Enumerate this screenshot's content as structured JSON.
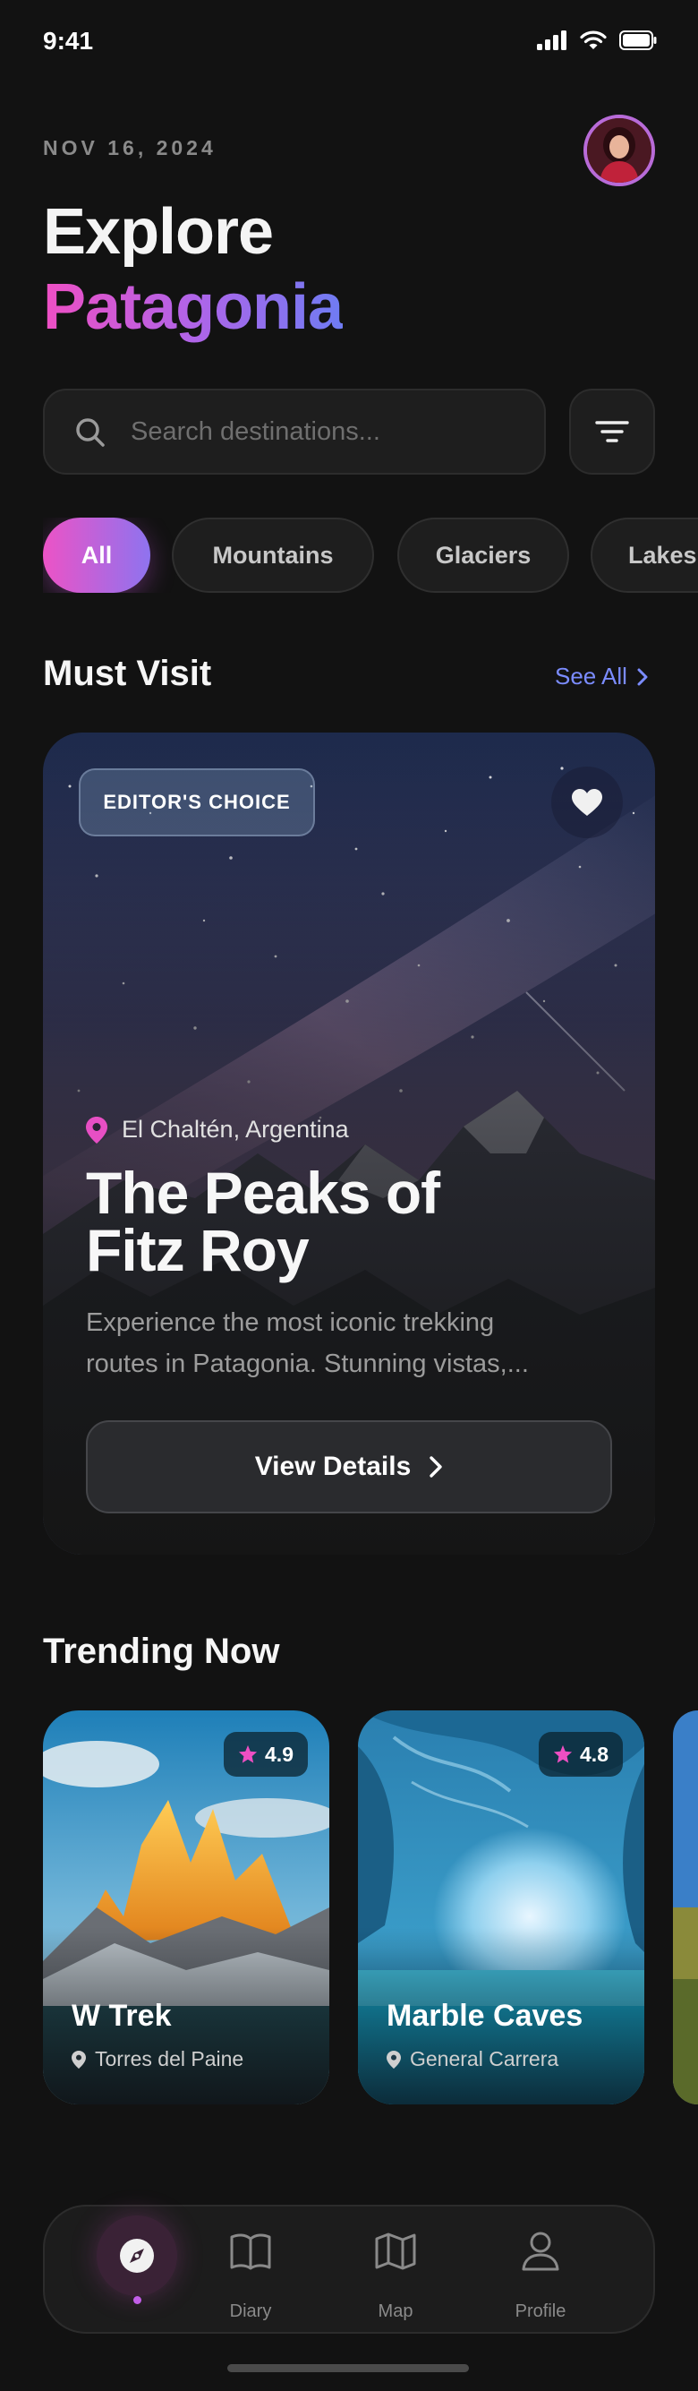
{
  "status_bar": {
    "time": "9:41",
    "icons": [
      "signal-icon",
      "wifi-icon",
      "battery-icon"
    ]
  },
  "header": {
    "date": "NOV 16, 2024",
    "title_line1": "Explore",
    "title_line2": "Patagonia",
    "avatar_icon": "user-avatar"
  },
  "search": {
    "placeholder": "Search destinations...",
    "value": "",
    "filter_icon": "filter-icon"
  },
  "categories": [
    {
      "label": "All",
      "active": true
    },
    {
      "label": "Mountains",
      "active": false
    },
    {
      "label": "Glaciers",
      "active": false
    },
    {
      "label": "Lakes",
      "active": false
    }
  ],
  "must_visit": {
    "section_title": "Must Visit",
    "see_all": "See All",
    "card": {
      "badge": "EDITOR'S CHOICE",
      "location": "El Chaltén, Argentina",
      "title_line1": "The Peaks of",
      "title_line2": "Fitz Roy",
      "description_line1": "Experience the most iconic trekking",
      "description_line2": "routes in Patagonia. Stunning vistas,...",
      "button": "View Details",
      "favorited": true
    }
  },
  "trending": {
    "section_title": "Trending Now",
    "items": [
      {
        "name": "W Trek",
        "location": "Torres del Paine",
        "rating": "4.9"
      },
      {
        "name": "Marble Caves",
        "location": "General Carrera",
        "rating": "4.8"
      }
    ]
  },
  "bottom_nav": {
    "items": [
      {
        "label": "",
        "icon": "compass-icon",
        "active": true
      },
      {
        "label": "Diary",
        "icon": "book-icon",
        "active": false
      },
      {
        "label": "Map",
        "icon": "map-icon",
        "active": false
      },
      {
        "label": "Profile",
        "icon": "user-icon",
        "active": false
      }
    ]
  },
  "colors": {
    "background": "#121212",
    "accent_pink": "#ec53c6",
    "accent_purple": "#8e73ef",
    "link": "#7b8cff"
  }
}
